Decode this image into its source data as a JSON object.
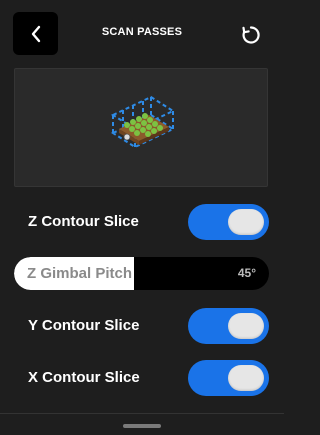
{
  "header": {
    "title": "SCAN PASSES",
    "back_icon": "chevron-left-icon",
    "reset_icon": "refresh-icon"
  },
  "preview": {
    "description_icon": "scan-volume-preview"
  },
  "controls": [
    {
      "label": "Z Contour Slice",
      "type": "toggle",
      "on": true
    },
    {
      "label": "Z Gimbal Pitch",
      "type": "slider",
      "value": "45°",
      "fill_fraction": 0.47
    },
    {
      "label": "Y Contour Slice",
      "type": "toggle",
      "on": true
    },
    {
      "label": "X Contour Slice",
      "type": "toggle",
      "on": true
    }
  ],
  "colors": {
    "background": "#1e1e1e",
    "accent": "#1a73e8",
    "knob": "#e6e6e6",
    "panel": "#2a2a2a"
  }
}
